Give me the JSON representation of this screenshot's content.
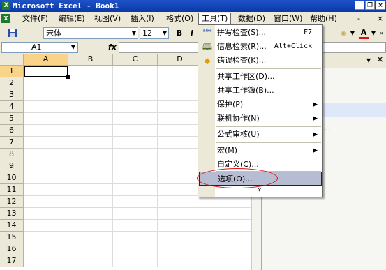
{
  "window": {
    "title": "Microsoft Excel - Book1",
    "app_icon": "excel-icon"
  },
  "menubar": {
    "items": [
      "文件(F)",
      "编辑(E)",
      "视图(V)",
      "插入(I)",
      "格式(O)",
      "工具(T)",
      "数据(D)",
      "窗口(W)",
      "帮助(H)"
    ],
    "right_controls": [
      "-",
      "×"
    ]
  },
  "toolbar": {
    "font_name": "宋体",
    "font_size": "12",
    "bold_label": "B",
    "italic_label": "I"
  },
  "formula_bar": {
    "name_box": "A1",
    "fx_label": "fx"
  },
  "sheet": {
    "columns": [
      "A",
      "B",
      "C",
      "D"
    ],
    "rows": [
      "1",
      "2",
      "3",
      "4",
      "5",
      "6",
      "7",
      "8",
      "9",
      "10",
      "11",
      "12",
      "13",
      "14",
      "15",
      "16",
      "17"
    ],
    "active_cell": "A1"
  },
  "task_pane": {
    "close_label": "×",
    "link_fragment": "..."
  },
  "tools_menu": {
    "items": [
      {
        "label": "拼写检查(S)...",
        "shortcut": "F7",
        "icon": "spell-check-icon"
      },
      {
        "label": "信息检索(R)...",
        "shortcut": "Alt+Click",
        "icon": "research-icon"
      },
      {
        "label": "错误检查(K)...",
        "icon": "error-check-icon"
      },
      {
        "label": "共享工作区(D)..."
      },
      {
        "label": "共享工作簿(B)..."
      },
      {
        "label": "保护(P)",
        "submenu": true
      },
      {
        "label": "联机协作(N)",
        "submenu": true
      },
      {
        "label": "公式审核(U)",
        "submenu": true
      },
      {
        "label": "宏(M)",
        "submenu": true
      },
      {
        "label": "自定义(C)..."
      },
      {
        "label": "选项(O)...",
        "highlighted": true
      }
    ],
    "expand_arrows": "»"
  },
  "annotation_color": "#dd1111"
}
